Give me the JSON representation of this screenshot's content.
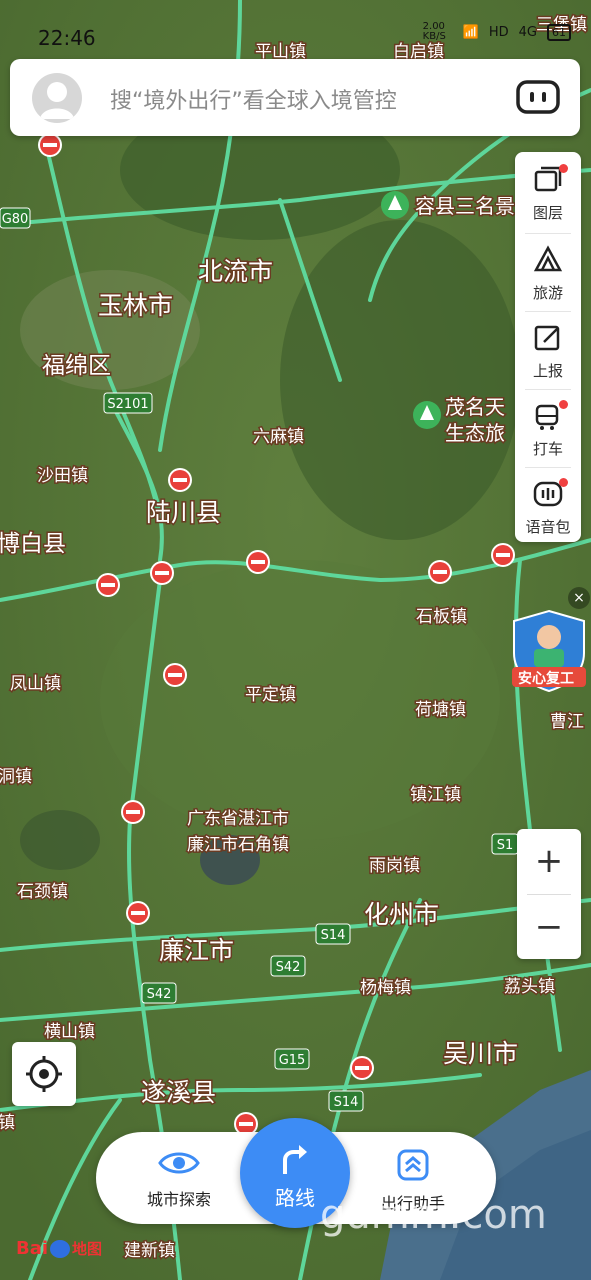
{
  "status": {
    "time": "22:46",
    "net_speed": "2.00 KB/S",
    "hd": "HD",
    "signal": "4G",
    "battery": "61"
  },
  "search": {
    "placeholder": "搜“境外出行”看全球入境管控"
  },
  "side_panel": [
    {
      "label": "图层",
      "icon": "layers-icon",
      "dot": true
    },
    {
      "label": "旅游",
      "icon": "tourism-icon",
      "dot": false
    },
    {
      "label": "上报",
      "icon": "report-icon",
      "dot": false
    },
    {
      "label": "打车",
      "icon": "taxi-icon",
      "dot": true
    },
    {
      "label": "语音包",
      "icon": "voice-pack-icon",
      "dot": true
    }
  ],
  "map_labels": {
    "top_town_1": "平山镇",
    "top_town_2": "白启镇",
    "top_town_3": "三堡镇",
    "scenic_1": "容县三名景",
    "scenic_2_line1": "茂名天",
    "scenic_2_line2": "生态旅",
    "city_yulin": "玉林市",
    "city_beiliu": "北流市",
    "district_fumian": "福绵区",
    "town_liuma": "六麻镇",
    "town_shatian": "沙田镇",
    "county_luchuan": "陆川县",
    "county_bobai": "博白县",
    "town_shiban": "石板镇",
    "town_fengshan": "凤山镇",
    "town_pingding": "平定镇",
    "town_hetang": "荷塘镇",
    "town_caojiang": "曹江",
    "town_mid_left": "洞镇",
    "town_zhenjiang": "镇江镇",
    "poi_line1": "广东省湛江市",
    "poi_line2": "廉江市石角镇",
    "town_shijing": "石颈镇",
    "town_yugang": "雨岗镇",
    "city_huazhou": "化州市",
    "city_lianjiang": "廉江市",
    "town_yangmei": "杨梅镇",
    "town_xietou": "荔头镇",
    "town_hengshan": "横山镇",
    "city_wuchuan": "吴川市",
    "county_suixi": "遂溪县",
    "town_bottom_left": "镇",
    "town_jianxin": "建新镇"
  },
  "road_shields": [
    "G80",
    "S2101",
    "S14",
    "S42",
    "S42",
    "G15",
    "S14",
    "S1"
  ],
  "promo": {
    "label": "安心复工",
    "close": "×"
  },
  "zoom": {
    "in": "+",
    "out": "−"
  },
  "bottom_bar": {
    "explore": "城市探索",
    "route": "路线",
    "assistant": "出行助手"
  },
  "logo": {
    "text": "Bai",
    "text2": "地图"
  },
  "watermark": "gdmm.com",
  "colors": {
    "road": "#5fdca0",
    "blocked": "#e8403a",
    "accent": "#3d8cf5",
    "label": "#7a3a26"
  }
}
